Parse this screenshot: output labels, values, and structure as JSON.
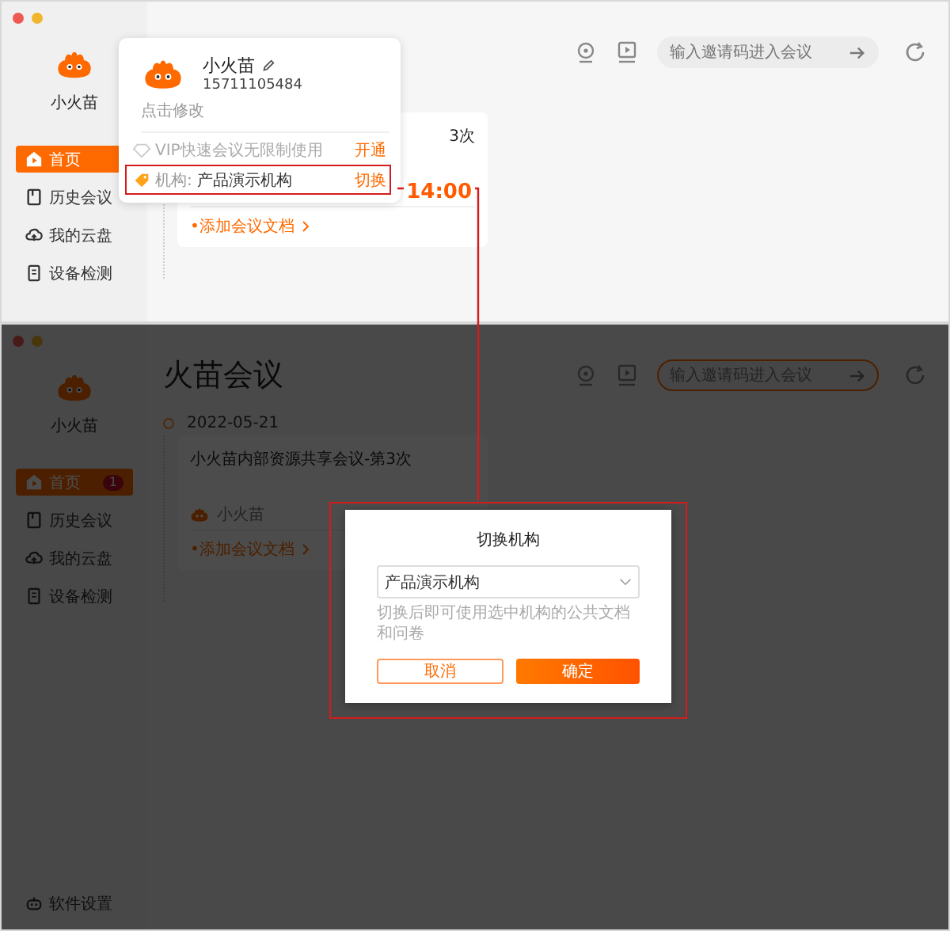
{
  "views": [
    {
      "dimmed": false,
      "sidebar": {
        "user_name": "小火苗",
        "nav": [
          {
            "label": "首页",
            "selected": true
          },
          {
            "label": "历史会议",
            "selected": false
          },
          {
            "label": "我的云盘",
            "selected": false
          },
          {
            "label": "设备检测",
            "selected": false
          }
        ]
      },
      "toolbar": {
        "search": {
          "placeholder": "输入邀请码进入会议",
          "highlighted": false
        }
      },
      "meeting": {
        "title": "3次",
        "time": "14:00",
        "add_doc": "•添加会议文档"
      },
      "popup": {
        "name": "小火苗",
        "phone": "15711105484",
        "edit_hint": "点击修改",
        "vip_text": "VIP快速会议无限制使用",
        "vip_action": "开通",
        "org_label": "机构:",
        "org_value": "产品演示机构",
        "org_action": "切换"
      }
    },
    {
      "dimmed": true,
      "sidebar": {
        "user_name": "小火苗",
        "nav": [
          {
            "label": "首页",
            "selected": true,
            "badge": "1"
          },
          {
            "label": "历史会议",
            "selected": false
          },
          {
            "label": "我的云盘",
            "selected": false
          },
          {
            "label": "设备检测",
            "selected": false
          }
        ],
        "settings": "软件设置"
      },
      "toolbar": {
        "search": {
          "placeholder": "输入邀请码进入会议",
          "highlighted": true
        }
      },
      "heading": "火苗会议",
      "date": "2022-05-21",
      "meeting": {
        "title": "小火苗内部资源共享会议-第3次",
        "host": "小火苗",
        "add_doc": "•添加会议文档"
      },
      "dialog": {
        "title": "切换机构",
        "select_value": "产品演示机构",
        "hint": "切换后即可使用选中机构的公共文档和问卷",
        "cancel": "取消",
        "confirm": "确定"
      }
    }
  ]
}
